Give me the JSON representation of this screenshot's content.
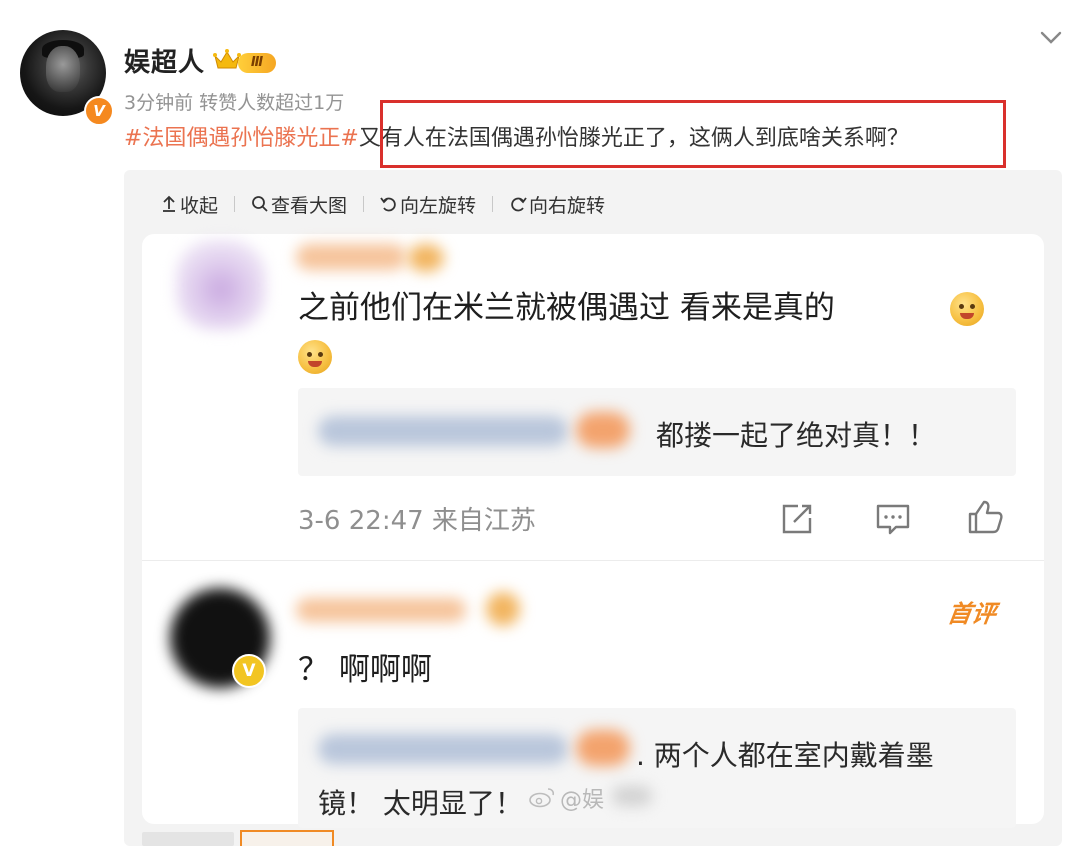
{
  "post": {
    "username": "娱超人",
    "level_badge": "Ⅲ",
    "verified_mark": "V",
    "meta": "3分钟前 转赞人数超过1万",
    "topic": "#法国偶遇孙怡滕光正#",
    "body": "又有人在法国偶遇孙怡滕光正了，这俩人到底啥关系啊？"
  },
  "toolbar": {
    "collapse_label": "收起",
    "view_large_label": "查看大图",
    "rotate_left_label": "向左旋转",
    "rotate_right_label": "向右旋转"
  },
  "screenshot": {
    "comment1": {
      "text": "之前他们在米兰就被偶遇过 看来是真的",
      "reply_text": "都搂一起了绝对真！！",
      "time_location": "3-6 22:47 来自江苏"
    },
    "comment2": {
      "first_comment_tag": "首评",
      "verified_mark": "V",
      "text": "？ 啊啊啊",
      "reply_line1": ". 两个人都在室内戴着墨",
      "reply_line2": "镜！ 太明显了！",
      "watermark": "@娱"
    }
  },
  "colors": {
    "topic_orange": "#eb7350",
    "highlight_red": "#d9302c",
    "first_comment_orange": "#f08a24",
    "verified_orange": "#f5891f"
  },
  "icons": [
    "crown-icon",
    "chevron-down-icon",
    "collapse-up-icon",
    "search-icon",
    "rotate-left-icon",
    "rotate-right-icon",
    "share-icon",
    "comment-icon",
    "like-icon",
    "weibo-icon",
    "emoji-icon"
  ]
}
